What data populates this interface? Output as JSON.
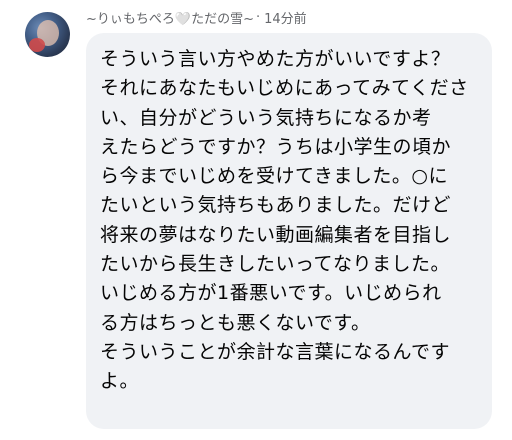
{
  "comment": {
    "author": "~りぃもちぺろ🤍ただの雪~",
    "separator": "·",
    "time": "14分前",
    "text": "そういう言い方やめた方がいいですよ？\nそれにあなたもいじめにあってみてくださ\nい、自分がどういう気持ちになるか考\nえたらどうですか？うちは小学生の頃か\nら今までいじめを受けてきました。○に\nたいという気持ちもありました。だけど\n将来の夢はなりたい動画編集者を目指し\nたいから長生きしたいってなりました。\nいじめる方が1番悪いです。いじめられ\nる方はちっとも悪くないです。\nそういうことが余計な言葉になるんです\nよ。"
  }
}
